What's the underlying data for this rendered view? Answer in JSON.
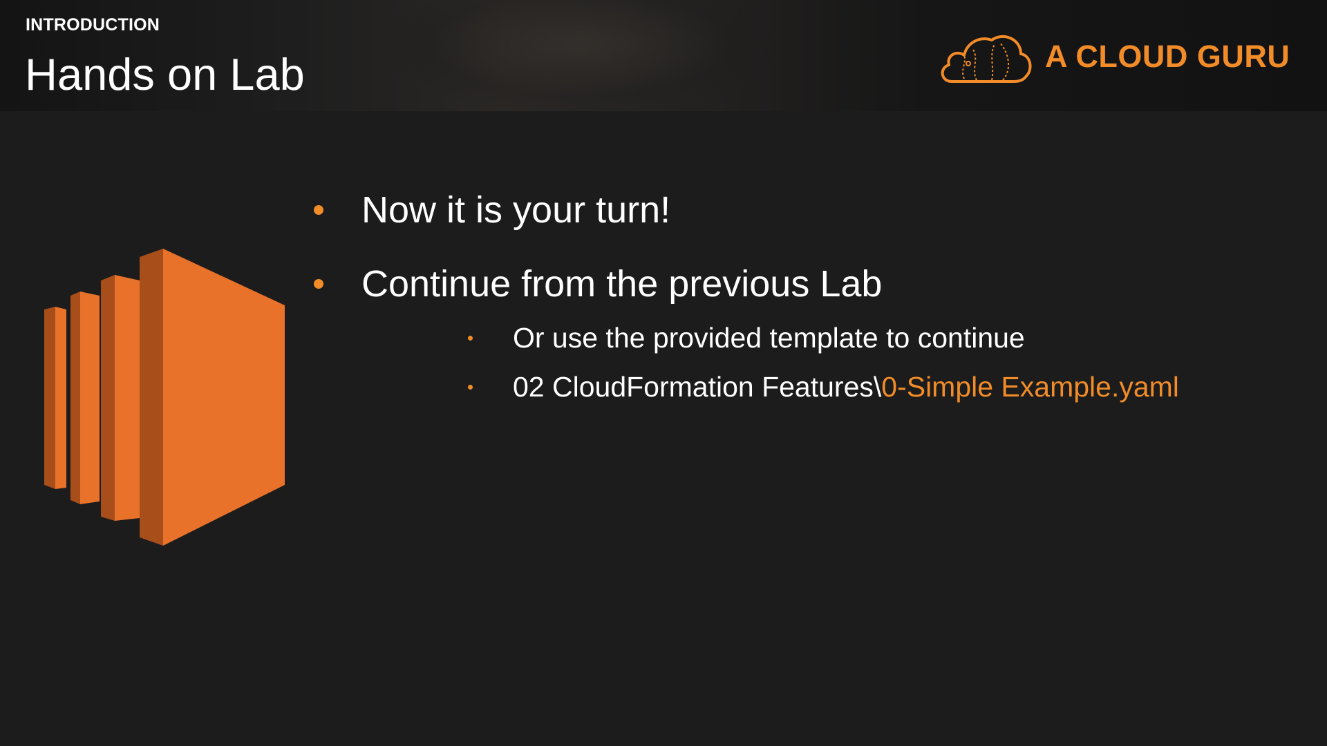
{
  "header": {
    "section_label": "INTRODUCTION",
    "title": "Hands on Lab"
  },
  "brand": {
    "name": "A CLOUD GURU",
    "icon": "cloud-icon",
    "color": "#f28c28"
  },
  "illustration": {
    "icon": "ec2-server-icon",
    "color": "#e8722a"
  },
  "bullets": [
    {
      "text": "Now it is your turn!"
    },
    {
      "text": "Continue from the previous Lab"
    }
  ],
  "sub_bullets": [
    {
      "text": "Or use the provided template to continue"
    },
    {
      "prefix": "02 CloudFormation Features\\",
      "highlight": "0-Simple Example.yaml"
    }
  ],
  "colors": {
    "background": "#1c1c1c",
    "accent": "#f28c28",
    "text": "#ffffff"
  }
}
